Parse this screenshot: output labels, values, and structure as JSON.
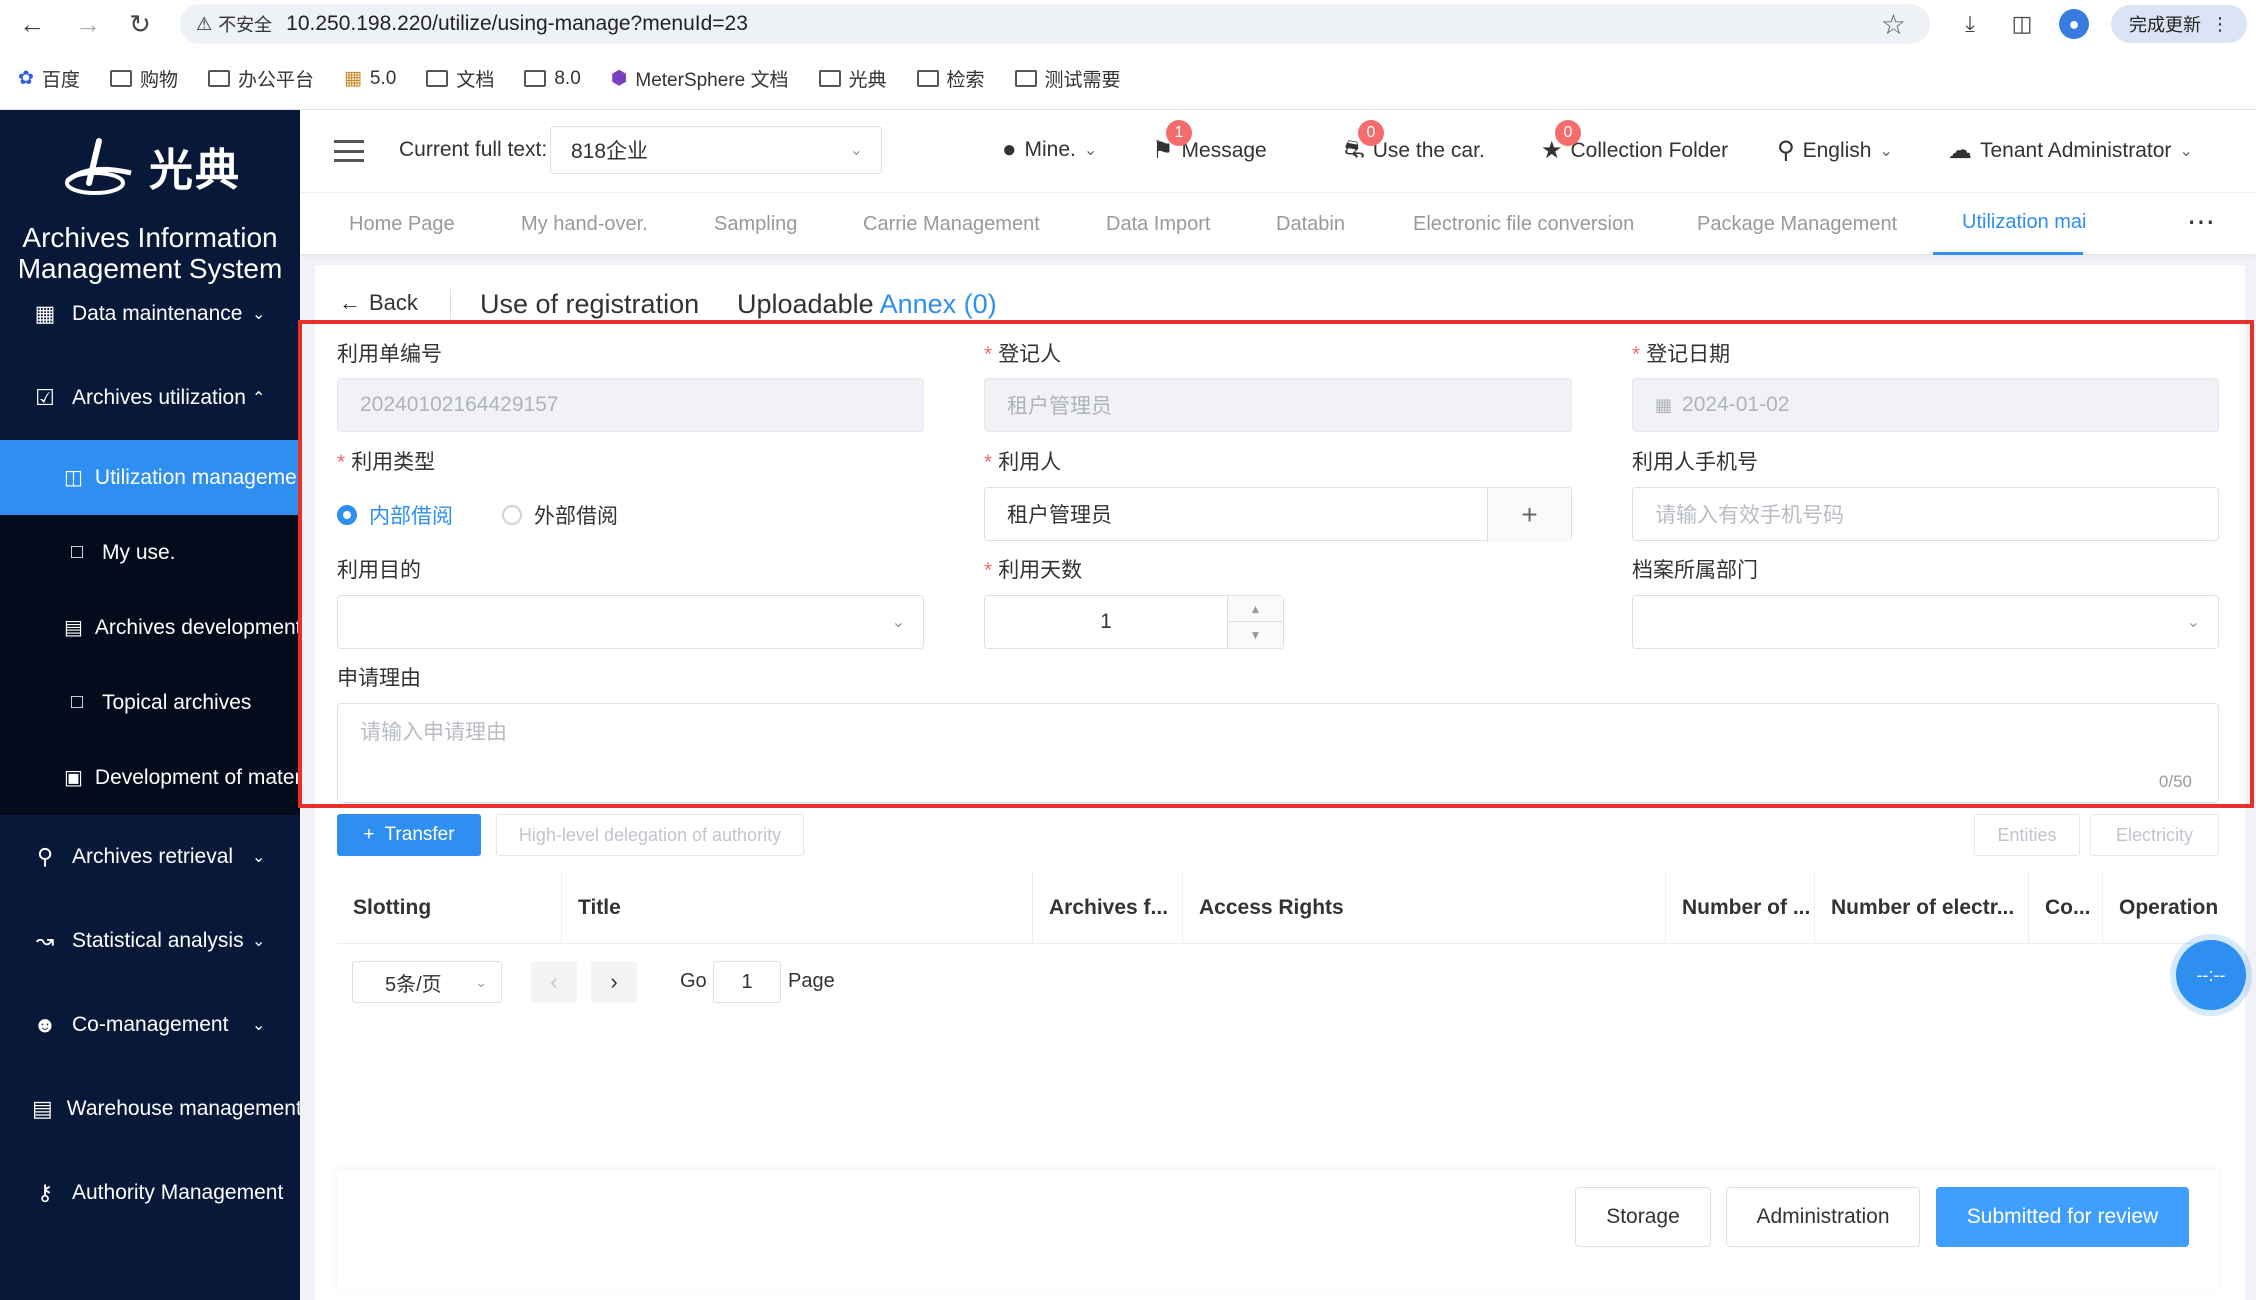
{
  "browser": {
    "insecure_label": "不安全",
    "url": "10.250.198.220/utilize/using-manage?menuId=23",
    "update_label": "完成更新",
    "bookmarks": [
      "百度",
      "购物",
      "办公平台",
      "5.0",
      "文档",
      "8.0",
      "MeterSphere 文档",
      "光典",
      "检索",
      "测试需要"
    ]
  },
  "sidebar": {
    "logo_text": "光典",
    "system_title": "Archives Information Management System",
    "items": [
      {
        "label": "Data maintenance",
        "icon": "building-icon"
      },
      {
        "label": "Archives utilization",
        "icon": "clipboard-check-icon"
      },
      {
        "label": "Archives retrieval",
        "icon": "search-icon"
      },
      {
        "label": "Statistical analysis",
        "icon": "chart-icon"
      },
      {
        "label": "Co-management",
        "icon": "users-icon"
      },
      {
        "label": "Warehouse management",
        "icon": "warehouse-icon"
      },
      {
        "label": "Authority Management",
        "icon": "key-icon"
      }
    ],
    "sub_items": [
      {
        "label": "Utilization management",
        "icon": "book-icon"
      },
      {
        "label": "My use.",
        "icon": "external-icon"
      },
      {
        "label": "Archives development",
        "icon": "document-icon"
      },
      {
        "label": "Topical archives",
        "icon": "folder-icon"
      },
      {
        "label": "Development of materials",
        "icon": "save-icon"
      }
    ]
  },
  "header": {
    "current_label": "Current full text:",
    "current_value": "818企业",
    "mine": "Mine.",
    "message": "Message",
    "message_count": "1",
    "car": "Use the car.",
    "car_count": "0",
    "collection": "Collection Folder",
    "collection_count": "0",
    "language": "English",
    "tenant": "Tenant Administrator"
  },
  "tabs": [
    "Home Page",
    "My hand-over.",
    "Sampling",
    "Carrie Management",
    "Data Import",
    "Databin",
    "Electronic file conversion",
    "Package Management",
    "Utilization mai"
  ],
  "card": {
    "back": "Back",
    "title": "Use of registration",
    "uploadable": "Uploadable",
    "annex": "Annex (0)"
  },
  "form": {
    "number_label": "利用单编号",
    "number_value": "20240102164429157",
    "registrant_label": "登记人",
    "registrant_value": "租户管理员",
    "reg_date_label": "登记日期",
    "reg_date_value": "2024-01-02",
    "type_label": "利用类型",
    "type_internal": "内部借阅",
    "type_external": "外部借阅",
    "user_label": "利用人",
    "user_value": "租户管理员",
    "phone_label": "利用人手机号",
    "phone_placeholder": "请输入有效手机号码",
    "purpose_label": "利用目的",
    "days_label": "利用天数",
    "days_value": "1",
    "dept_label": "档案所属部门",
    "reason_label": "申请理由",
    "reason_placeholder": "请输入申请理由",
    "reason_counter": "0/50"
  },
  "toolbar": {
    "transfer": "Transfer",
    "delegation": "High-level delegation of authority",
    "entities": "Entities",
    "electricity": "Electricity"
  },
  "table": {
    "headers": [
      "Slotting",
      "Title",
      "Archives f...",
      "Access Rights",
      "Number of ...",
      "Number of electr...",
      "Co...",
      "Operation"
    ]
  },
  "pager": {
    "page_size": "5条/页",
    "go": "Go",
    "page_input": "1",
    "page": "Page"
  },
  "float_label": "--:--",
  "footer": {
    "storage": "Storage",
    "administration": "Administration",
    "submit": "Submitted for review"
  }
}
